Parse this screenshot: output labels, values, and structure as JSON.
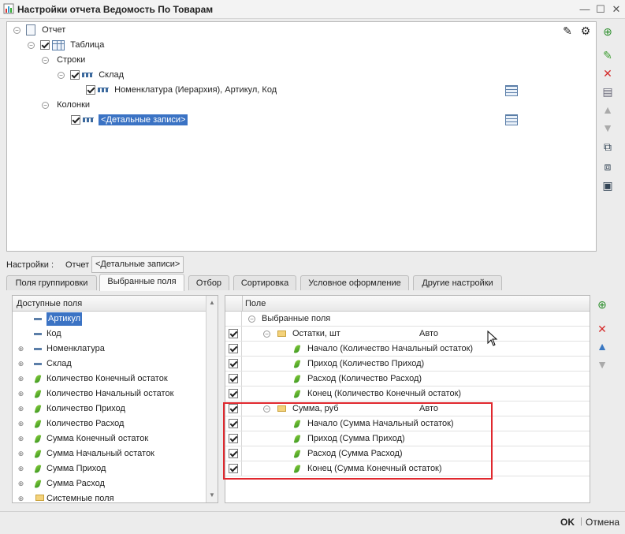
{
  "window": {
    "title": "Настройки отчета  Ведомость По Товарам",
    "controls": [
      "minimize-icon",
      "maximize-icon",
      "close-icon"
    ]
  },
  "tree": {
    "root": "Отчет",
    "table": "Таблица",
    "rows_label": "Строки",
    "sklad": "Склад",
    "sklad_fields": "Номенклатура (Иерархия), Артикул, Код",
    "columns_label": "Колонки",
    "detail": "<Детальные записи>"
  },
  "settings": {
    "label": "Настройки :",
    "otchet": "Отчет",
    "field": "<Детальные записи>"
  },
  "tabs": [
    {
      "label": "Поля группировки"
    },
    {
      "label": "Выбранные поля",
      "active": true
    },
    {
      "label": "Отбор"
    },
    {
      "label": "Сортировка"
    },
    {
      "label": "Условное оформление"
    },
    {
      "label": "Другие настройки"
    }
  ],
  "available": {
    "header": "Доступные поля",
    "items": [
      {
        "label": "Артикул",
        "icon": "dash",
        "expand": false,
        "selected": true
      },
      {
        "label": "Код",
        "icon": "dash",
        "expand": false
      },
      {
        "label": "Номенклатура",
        "icon": "dash",
        "expand": true
      },
      {
        "label": "Склад",
        "icon": "dash",
        "expand": true
      },
      {
        "label": "Количество Конечный остаток",
        "icon": "leaf",
        "expand": true
      },
      {
        "label": "Количество Начальный остаток",
        "icon": "leaf",
        "expand": true
      },
      {
        "label": "Количество Приход",
        "icon": "leaf",
        "expand": true
      },
      {
        "label": "Количество Расход",
        "icon": "leaf",
        "expand": true
      },
      {
        "label": "Сумма Конечный остаток",
        "icon": "leaf",
        "expand": true
      },
      {
        "label": "Сумма Начальный остаток",
        "icon": "leaf",
        "expand": true
      },
      {
        "label": "Сумма Приход",
        "icon": "leaf",
        "expand": true
      },
      {
        "label": "Сумма Расход",
        "icon": "leaf",
        "expand": true
      },
      {
        "label": "Системные поля",
        "icon": "folder",
        "expand": true
      }
    ]
  },
  "selected": {
    "header": "Поле",
    "root": "Выбранные поля",
    "rows": [
      {
        "label": "Остатки, шт",
        "value": "Авто",
        "type": "folder",
        "level": 1
      },
      {
        "label": "Начало (Количество Начальный остаток)",
        "type": "leaf",
        "level": 2
      },
      {
        "label": "Приход (Количество Приход)",
        "type": "leaf",
        "level": 2
      },
      {
        "label": "Расход (Количество Расход)",
        "type": "leaf",
        "level": 2
      },
      {
        "label": "Конец (Количество Конечный остаток)",
        "type": "leaf",
        "level": 2
      },
      {
        "label": "Сумма, руб",
        "value": "Авто",
        "type": "folder",
        "level": 1
      },
      {
        "label": "Начало (Сумма Начальный остаток)",
        "type": "leaf",
        "level": 2
      },
      {
        "label": "Приход (Сумма Приход)",
        "type": "leaf",
        "level": 2
      },
      {
        "label": "Расход (Сумма Расход)",
        "type": "leaf",
        "level": 2
      },
      {
        "label": "Конец (Сумма Конечный остаток)",
        "type": "leaf",
        "level": 2
      }
    ]
  },
  "buttons": {
    "ok": "OK",
    "cancel": "Отмена"
  },
  "colors": {
    "selection": "#3b73c4",
    "highlight_box": "#e0282e"
  }
}
